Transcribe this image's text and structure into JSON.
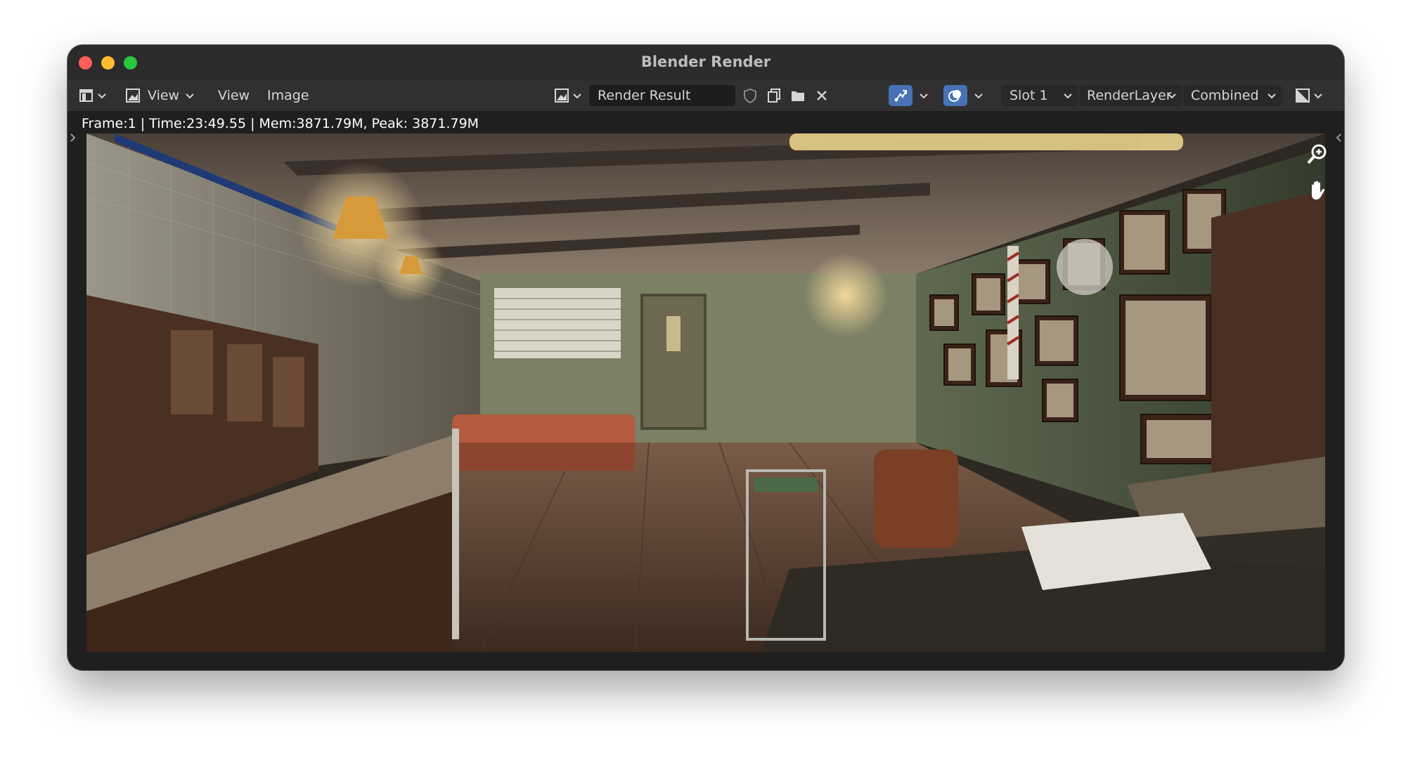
{
  "window": {
    "title": "Blender Render"
  },
  "toolbar": {
    "editor_type_icon": "image-editor-icon",
    "view_mode_label": "View",
    "menu_view": "View",
    "menu_image": "Image",
    "image_name": "Render Result",
    "slot_label": "Slot 1",
    "layer_label": "RenderLayer",
    "pass_label": "Combined"
  },
  "status": {
    "frame_info": "Frame:1 | Time:23:49.55 | Mem:3871.79M, Peak: 3871.79M"
  },
  "colors": {
    "accent": "#4772b3",
    "close": "#ff5f57",
    "minimize": "#febc2e",
    "maximize": "#28c840"
  }
}
